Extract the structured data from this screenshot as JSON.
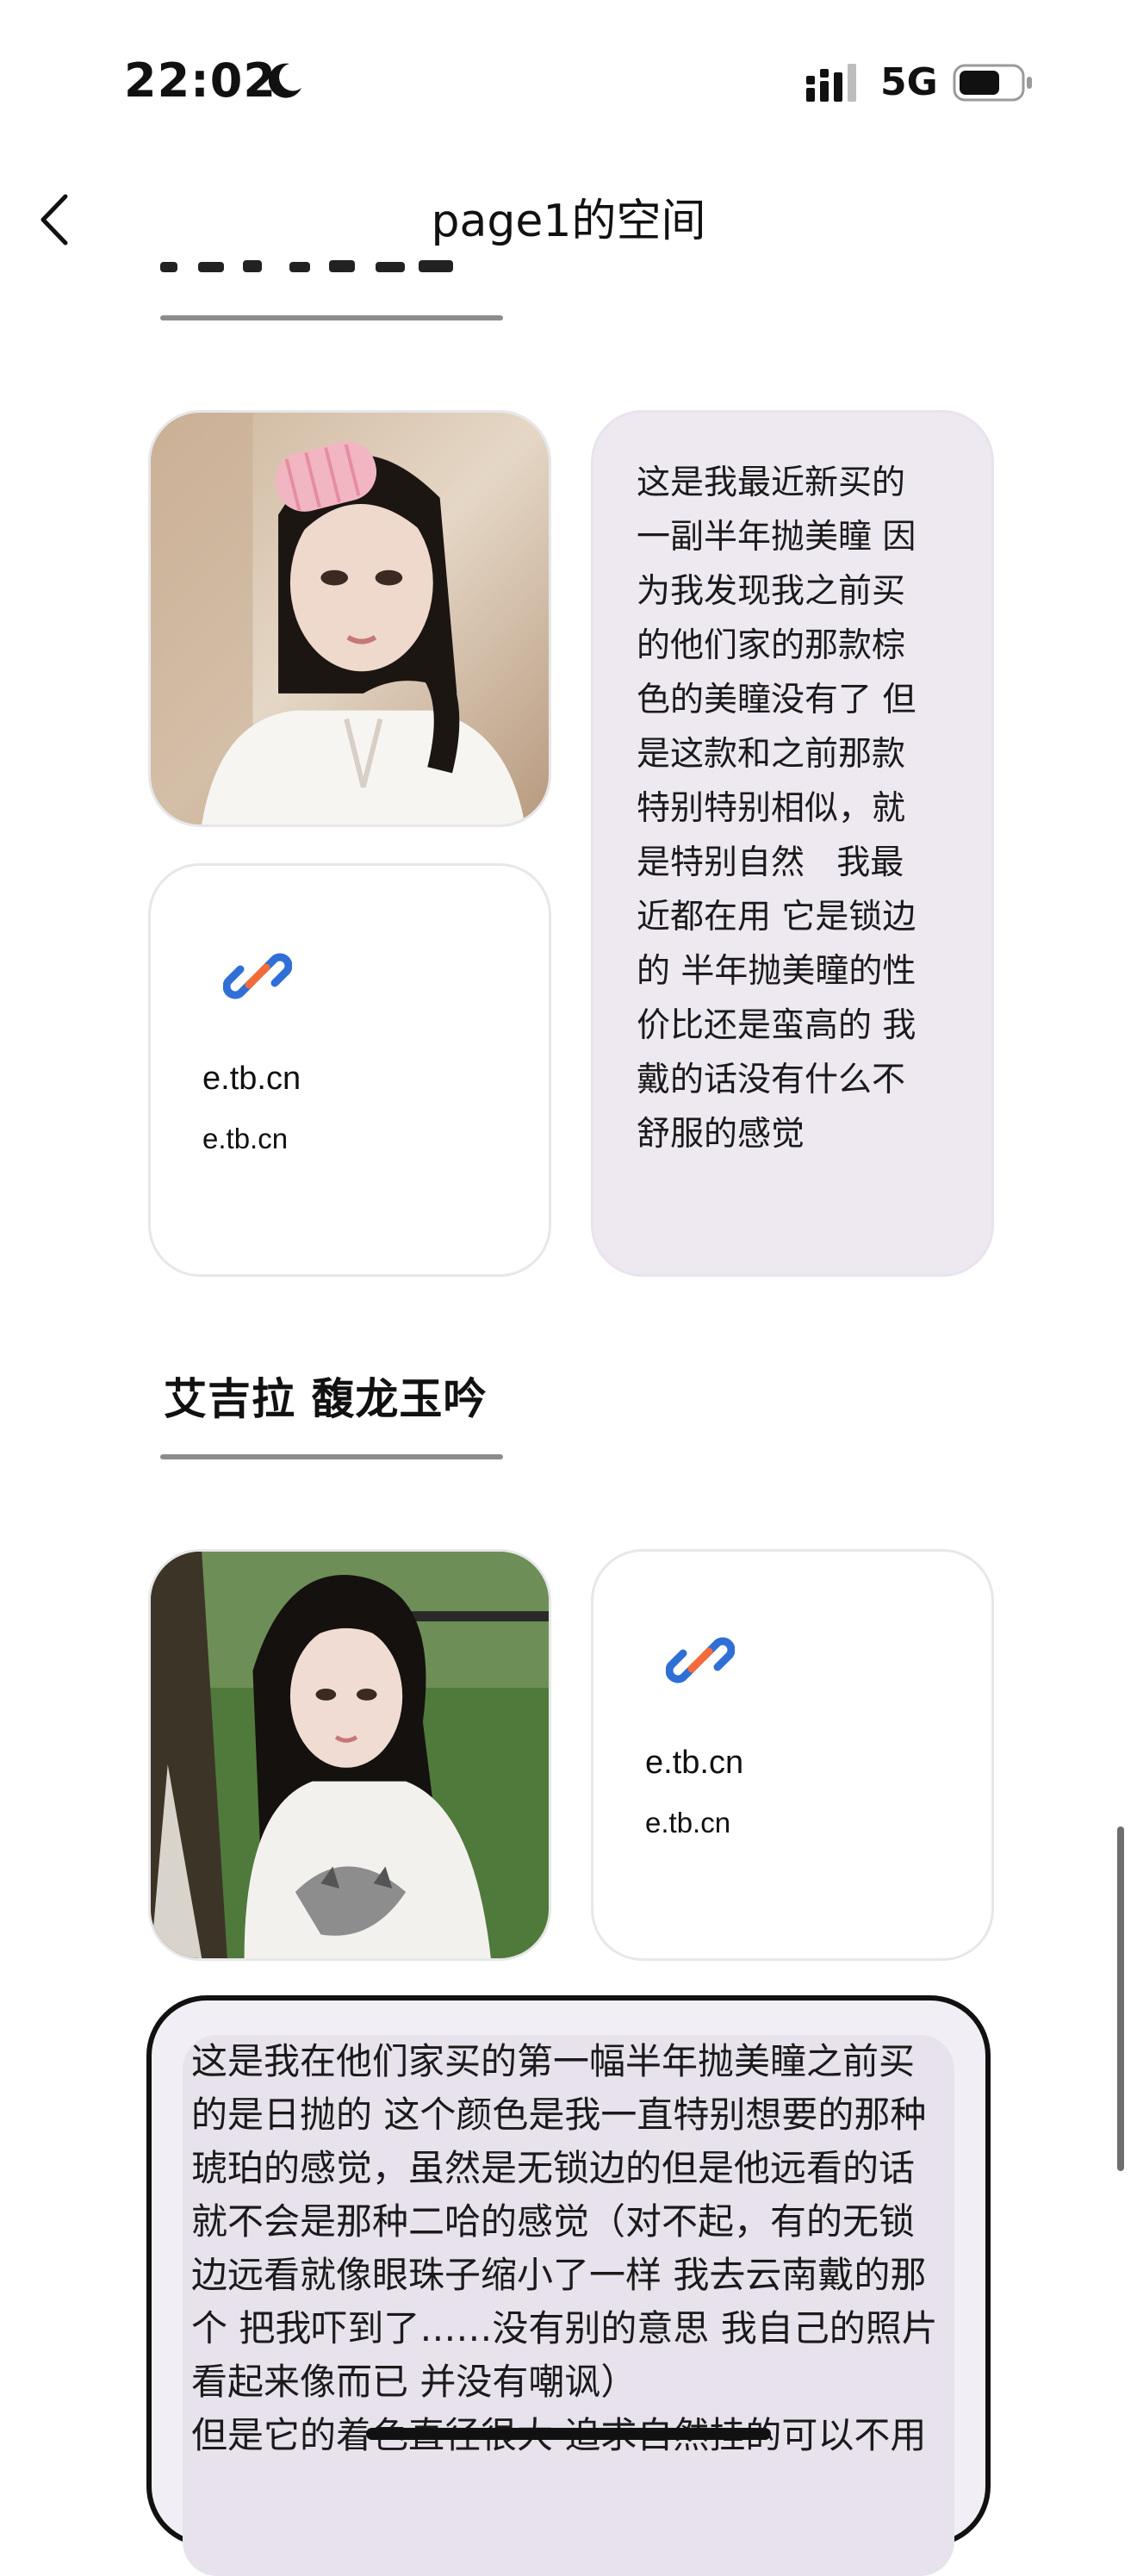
{
  "status_bar": {
    "time": "22:02",
    "network": "5G"
  },
  "nav": {
    "title": "page1的空间"
  },
  "section1": {
    "text_card": "这是我最近新买的\n一副半年抛美瞳 因\n为我发现我之前买\n的他们家的那款棕\n色的美瞳没有了 但\n是这款和之前那款\n特别特别相似，就\n是特别自然   我最\n近都在用 它是锁边\n的 半年抛美瞳的性\n价比还是蛮高的 我\n戴的话没有什么不\n舒服的感觉",
    "link_card": {
      "title": "e.tb.cn",
      "subtitle": "e.tb.cn"
    }
  },
  "section2": {
    "title": "艾吉拉 馥龙玉吟",
    "link_card": {
      "title": "e.tb.cn",
      "subtitle": "e.tb.cn"
    },
    "text_lines": [
      "这是我在他们家买的第一幅半年抛美瞳之前买",
      "的是日抛的 这个颜色是我一直特别想要的那种",
      "琥珀的感觉，虽然是无锁边的但是他远看的话",
      "就不会是那种二哈的感觉（对不起，有的无锁",
      "边远看就像眼珠子缩小了一样 我去云南戴的那",
      "个 把我吓到了……没有别的意思 我自己的照片",
      "看起来像而已 并没有嘲讽）",
      "但是它的着色直径很大 追求自然挂的可以不用"
    ]
  },
  "colors": {
    "accent_blue": "#2f6fd6",
    "accent_orange": "#f26b3a",
    "card_lavender": "#eee8f1"
  }
}
